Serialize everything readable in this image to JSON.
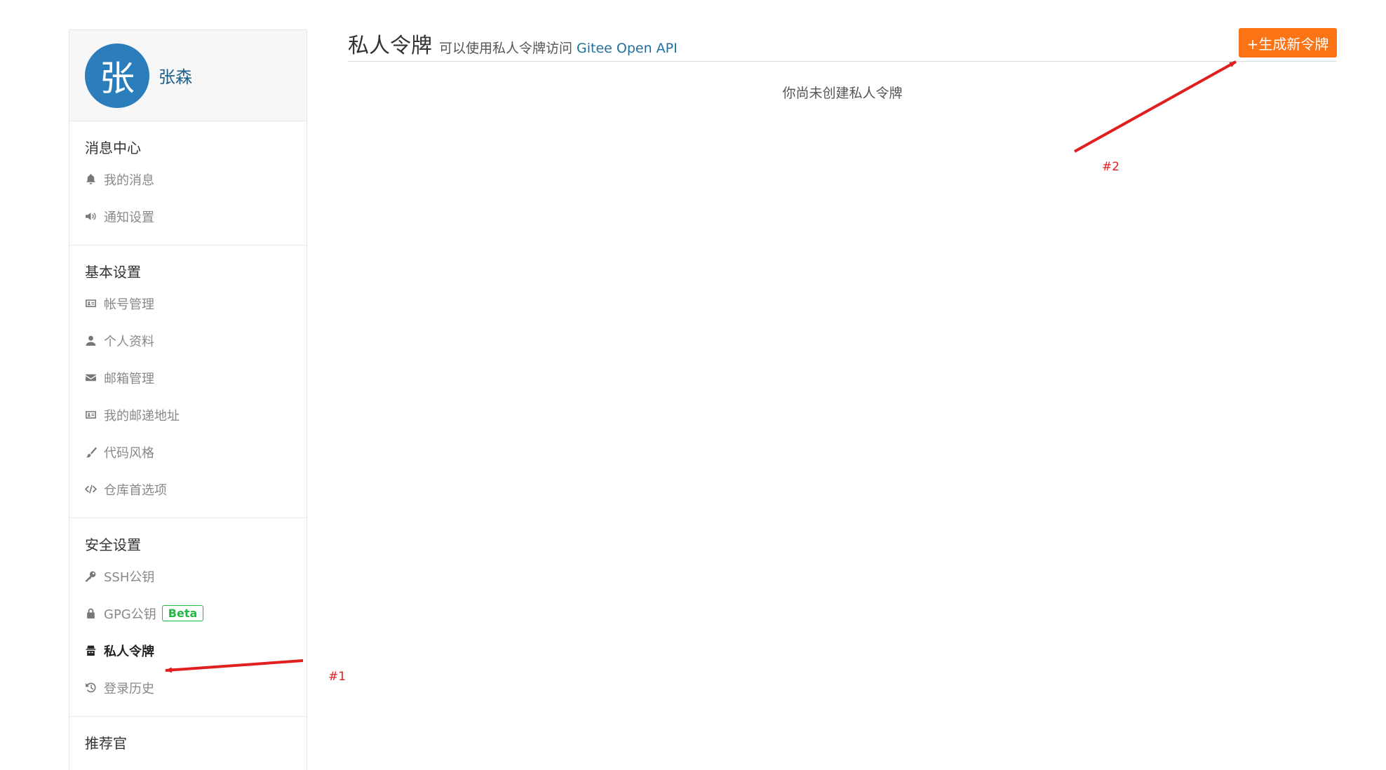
{
  "user": {
    "avatar_char": "张",
    "name": "张森"
  },
  "sidebar": {
    "sections": [
      {
        "title": "消息中心",
        "items": [
          {
            "label": "我的消息",
            "icon": "bell-icon"
          },
          {
            "label": "通知设置",
            "icon": "volume-icon"
          }
        ]
      },
      {
        "title": "基本设置",
        "items": [
          {
            "label": "帐号管理",
            "icon": "id-card-icon"
          },
          {
            "label": "个人资料",
            "icon": "user-icon"
          },
          {
            "label": "邮箱管理",
            "icon": "envelope-icon"
          },
          {
            "label": "我的邮递地址",
            "icon": "id-card-icon"
          },
          {
            "label": "代码风格",
            "icon": "brush-icon"
          },
          {
            "label": "仓库首选项",
            "icon": "code-icon"
          }
        ]
      },
      {
        "title": "安全设置",
        "items": [
          {
            "label": "SSH公钥",
            "icon": "key-icon"
          },
          {
            "label": "GPG公钥",
            "icon": "lock-icon",
            "badge": "Beta"
          },
          {
            "label": "私人令牌",
            "icon": "spy-icon",
            "active": true
          },
          {
            "label": "登录历史",
            "icon": "history-icon"
          }
        ]
      },
      {
        "title": "推荐官",
        "items": []
      }
    ]
  },
  "main": {
    "title": "私人令牌",
    "subtitle": "可以使用私人令牌访问",
    "subtitle_link": "Gitee Open API",
    "new_button": "+生成新令牌",
    "empty_text": "你尚未创建私人令牌"
  },
  "annotations": {
    "first": "#1",
    "second": "#2"
  },
  "colors": {
    "accent": "#fa7314",
    "avatar": "#2b7dbc",
    "annotation": "#e02020",
    "beta": "#21ba45"
  }
}
